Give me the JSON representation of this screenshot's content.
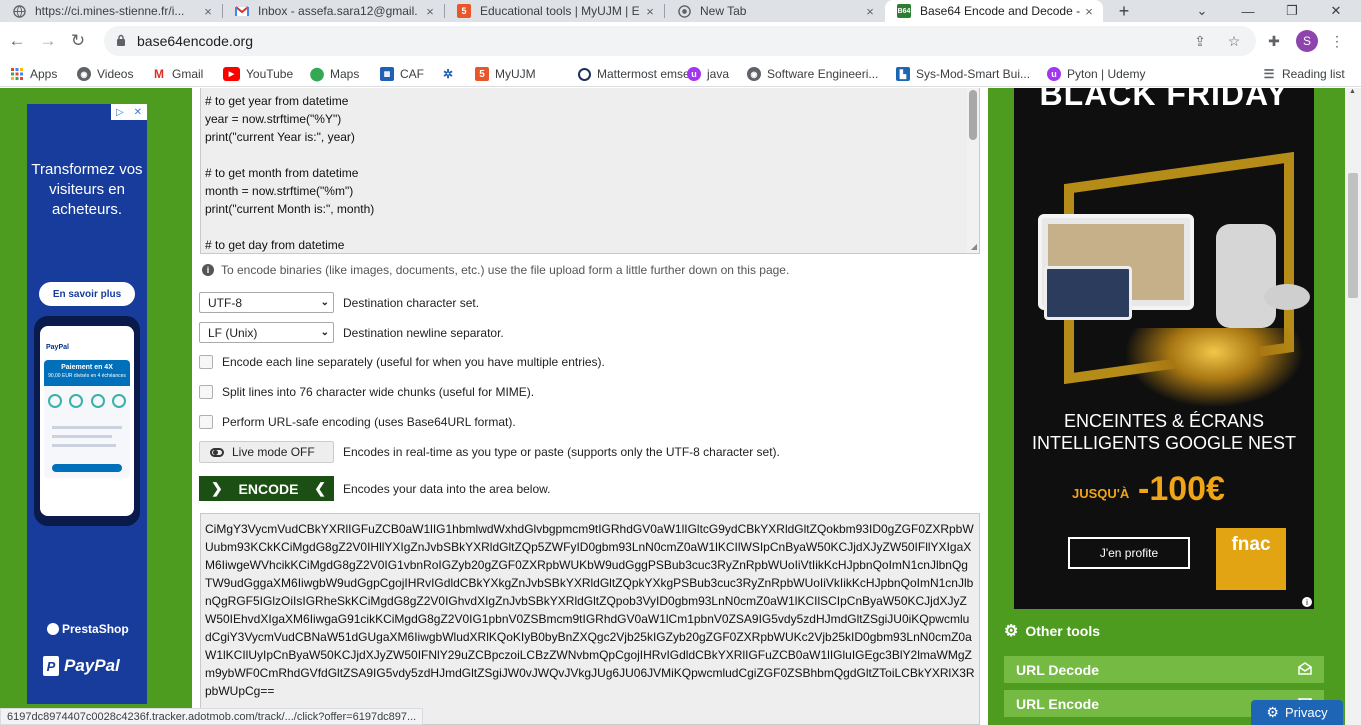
{
  "browser": {
    "tabs": [
      {
        "title": "https://ci.mines-stienne.fr/i...",
        "icon": "globe-icon"
      },
      {
        "title": "Inbox - assefa.sara12@gmail.",
        "icon": "gmail-icon"
      },
      {
        "title": "Educational tools | MyUJM | E",
        "icon": "myujm-icon"
      },
      {
        "title": "New Tab",
        "icon": "chrome-icon"
      },
      {
        "title": "Base64 Encode and Decode -",
        "icon": "base64-icon",
        "active": true
      }
    ],
    "favicon_b64": "B64",
    "new_tab": "+",
    "close": "×",
    "window_controls": {
      "dropdown": "⌄",
      "minimize": "—",
      "restore": "❐",
      "close": "✕"
    },
    "url": "base64encode.org",
    "avatar_letter": "S",
    "bookmarks": [
      {
        "label": "Apps",
        "icon": "apps-icon"
      },
      {
        "label": "Videos",
        "icon": "globe-icon"
      },
      {
        "label": "Gmail",
        "icon": "gmail-icon"
      },
      {
        "label": "YouTube",
        "icon": "youtube-icon"
      },
      {
        "label": "Maps",
        "icon": "maps-icon"
      },
      {
        "label": "CAF",
        "icon": "caf-icon"
      },
      {
        "label": "",
        "icon": "globe-icon"
      },
      {
        "label": "MyUJM",
        "icon": "myujm-icon"
      },
      {
        "label": "Mattermost emse",
        "icon": "mattermost-icon"
      },
      {
        "label": "java",
        "icon": "udemy-icon"
      },
      {
        "label": "Software Engineeri...",
        "icon": "globe-icon"
      },
      {
        "label": "Sys-Mod-Smart Bui...",
        "icon": "bookmark-icon"
      },
      {
        "label": "Pyton | Udemy",
        "icon": "udemy-icon"
      }
    ],
    "reading_list": "Reading list"
  },
  "left_ad": {
    "headline": "Transformez vos visiteurs en acheteurs.",
    "cta": "En savoir plus",
    "phone_brand": "PayPal",
    "phone_title": "Paiement en 4X",
    "phone_sub": "90,00 EUR divisés en 4 échéances",
    "brand1": "PrestaShop",
    "brand2": "PayPal"
  },
  "editor": {
    "input_lines": [
      "# to get year from datetime",
      "year = now.strftime(\"%Y\")",
      "print(\"current Year is:\", year)",
      "",
      "# to get month from datetime",
      "month = now.strftime(\"%m\")",
      "print(\"current Month is:\", month)",
      "",
      "# to get day from datetime"
    ],
    "info": "To encode binaries (like images, documents, etc.) use the file upload form a little further down on this page.",
    "charset": {
      "value": "UTF-8",
      "label": "Destination character set."
    },
    "newline": {
      "value": "LF (Unix)",
      "label": "Destination newline separator."
    },
    "options": [
      {
        "label": "Encode each line separately (useful for when you have multiple entries).",
        "checked": false
      },
      {
        "label": "Split lines into 76 character wide chunks (useful for MIME).",
        "checked": false
      },
      {
        "label": "Perform URL-safe encoding (uses Base64URL format).",
        "checked": false
      }
    ],
    "live_mode": {
      "label": "Live mode OFF",
      "desc": "Encodes in real-time as you type or paste (supports only the UTF-8 character set)."
    },
    "encode": {
      "label": "ENCODE",
      "desc": "Encodes your data into the area below."
    },
    "output": "CiMgY3VycmVudCBkYXRlIGFuZCB0aW1lIG1hbmlwdWxhdGlvbgpmcm9tIGRhdGV0aW1lIGltcG9ydCBkYXRldGltZQokbm93ID0gZGF0ZXRpbWUubm93KCkKCiMgdG8gZ2V0IHllYXIgZnJvbSBkYXRldGltZQp5ZWFyID0gbm93LnN0cmZ0aW1lKCIlWSIpCnByaW50KCJjdXJyZW50IFllYXIgaXM6IiwgeWVhcikKCiMgdG8gZ2V0IG1vbnRoIGZyb20gZGF0ZXRpbWUKbW9udGggPSBub3cuc3RyZnRpbWUoIiVtIikKcHJpbnQoImN1cnJlbnQgTW9udGggaXM6IiwgbW9udGgpCgojIHRvIGdldCBkYXkgZnJvbSBkYXRldGltZQpkYXkgPSBub3cuc3RyZnRpbWUoIiVkIikKcHJpbnQoImN1cnJlbnQgRGF5IGlzOiIsIGRheSkKCiMgdG8gZ2V0IGhvdXIgZnJvbSBkYXRldGltZQpob3VyID0gbm93LnN0cmZ0aW1lKCIlSCIpCnByaW50KCJjdXJyZW50IEhvdXIgaXM6IiwgaG91cikKCiMgdG8gZ2V0IG1pbnV0ZSBmcm9tIGRhdGV0aW1lCm1pbnV0ZSA9IG5vdy5zdHJmdGltZSgiJU0iKQpwcmludCgiY3VycmVudCBNaW51dGUgaXM6IiwgbWludXRlKQoKIyB0byBnZXQgc2Vjb25kIGZyb20gZGF0ZXRpbWUKc2Vjb25kID0gbm93LnN0cmZ0aW1lKCIlUyIpCnByaW50KCJjdXJyZW50IFNlY29uZCBpczoiLCBzZWNvbmQpCgojIHRvIGdldCBkYXRlIGFuZCB0aW1lIGluIGEgc3BlY2lmaWMgZm9ybWF0CmRhdGVfdGltZSA9IG5vdy5zdHJmdGltZSgiJW0vJWQvJVkgJUg6JU06JVMiKQpwcmludCgiZGF0ZSBhbmQgdGltZToiLCBkYXRlX3RpbWUpCg=="
  },
  "right_ad": {
    "top_text": "BLACK FRIDAY",
    "headline": "ENCEINTES & ÉCRANS INTELLIGENTS GOOGLE NEST",
    "jusqua": "JUSQU'À",
    "discount": "-100€",
    "cta": "J'en profite",
    "brand": "fnac"
  },
  "sidebar": {
    "other_tools": "Other tools",
    "tools": [
      {
        "label": "URL Decode",
        "icon": "envelope-open-icon"
      },
      {
        "label": "URL Encode",
        "icon": "envelope-icon"
      }
    ]
  },
  "status_url": "6197dc8974407c0028c4236f.tracker.adotmob.com/track/.../click?offer=6197dc897...",
  "privacy": "Privacy",
  "colors": {
    "brand_green": "#4d9c1f",
    "encode_btn": "#1c4f13",
    "tool_btn": "#75bb43",
    "privacy_btn": "#1f65b6"
  }
}
